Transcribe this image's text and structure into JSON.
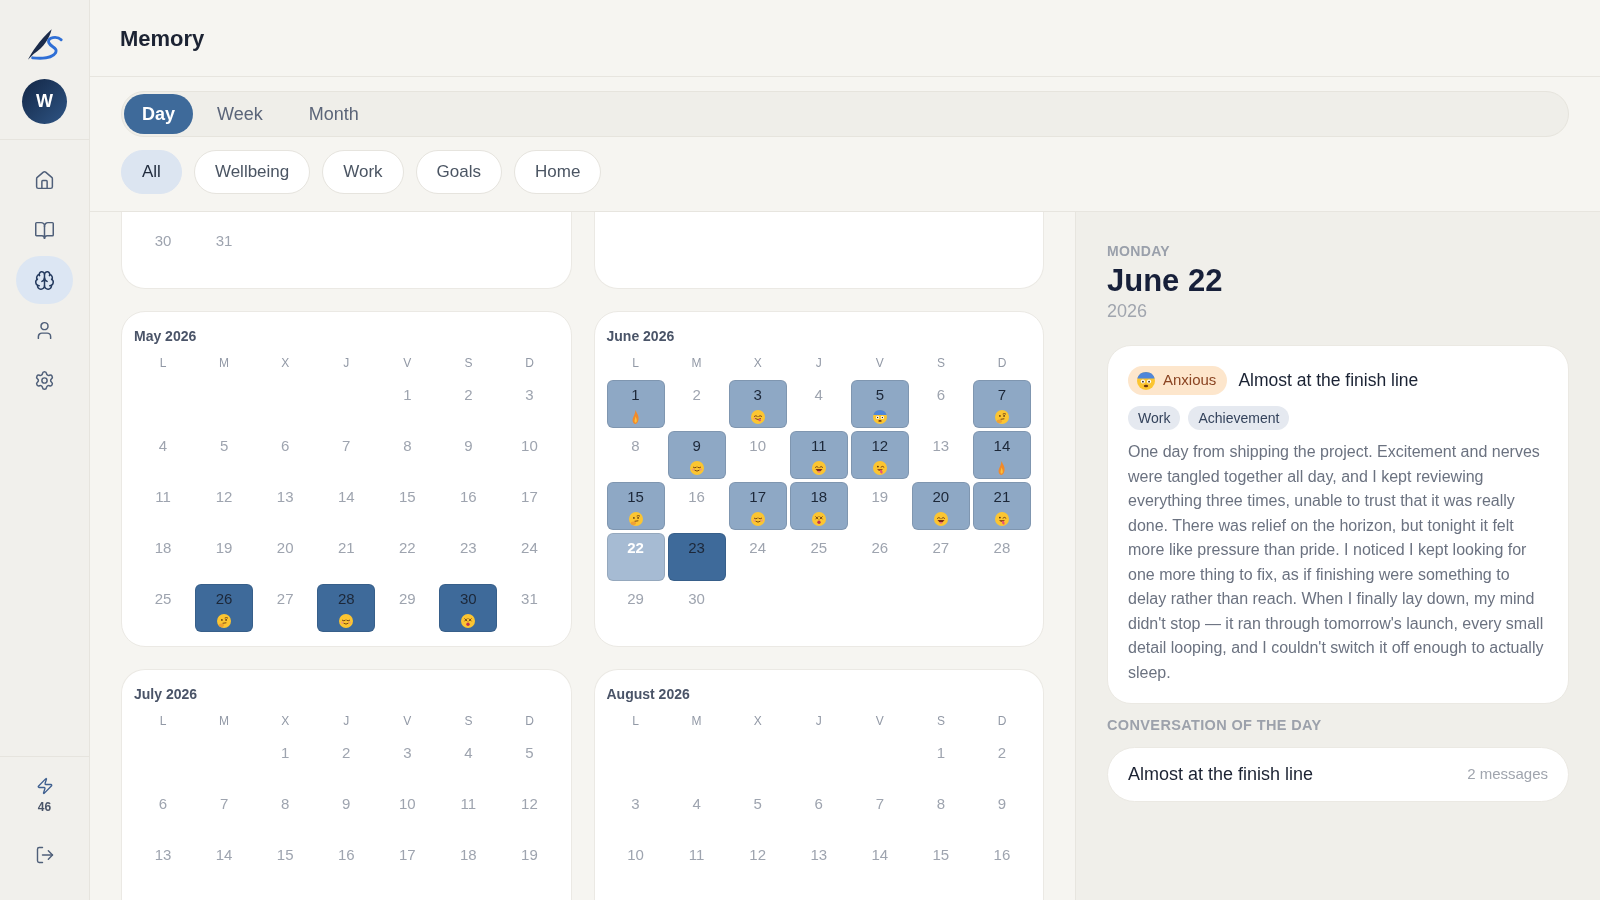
{
  "sidebar": {
    "avatar": {
      "initial": "W"
    },
    "nav": [
      {
        "kind": "home",
        "selected": false
      },
      {
        "kind": "journal",
        "selected": false
      },
      {
        "kind": "memory",
        "selected": true
      },
      {
        "kind": "profile",
        "selected": false
      },
      {
        "kind": "settings",
        "selected": false
      }
    ],
    "energy": {
      "count": "46"
    }
  },
  "header": {
    "title": "Memory"
  },
  "view_tabs": [
    {
      "label": "Day",
      "selected": true
    },
    {
      "label": "Week",
      "selected": false
    },
    {
      "label": "Month",
      "selected": false
    }
  ],
  "filters": [
    {
      "label": "All",
      "selected": true
    },
    {
      "label": "Wellbeing",
      "selected": false
    },
    {
      "label": "Work",
      "selected": false
    },
    {
      "label": "Goals",
      "selected": false
    },
    {
      "label": "Home",
      "selected": false
    }
  ],
  "calendar": {
    "months": [
      {
        "kind": "partial",
        "weeks": [
          [
            {
              "day": "30",
              "selected": false
            },
            {
              "day": "31",
              "selected": false
            }
          ]
        ]
      },
      {
        "kind": "partial"
      },
      {
        "kind": "month",
        "title": "May 2026",
        "weekdays": [
          "L",
          "M",
          "X",
          "J",
          "V",
          "S",
          "D"
        ],
        "weeks": [
          [
            {
              "day": "1",
              "selected": false
            },
            {
              "day": "2",
              "selected": false
            },
            {
              "day": "3",
              "selected": false
            }
          ],
          [
            {
              "day": "4",
              "selected": false
            },
            {
              "day": "5",
              "selected": false
            },
            {
              "day": "6",
              "selected": false
            },
            {
              "day": "7",
              "selected": false
            },
            {
              "day": "8",
              "selected": false
            },
            {
              "day": "9",
              "selected": false
            },
            {
              "day": "10",
              "selected": false
            }
          ],
          [
            {
              "day": "11",
              "selected": false
            },
            {
              "day": "12",
              "selected": false
            },
            {
              "day": "13",
              "selected": false
            },
            {
              "day": "14",
              "selected": false
            },
            {
              "day": "15",
              "selected": false
            },
            {
              "day": "16",
              "selected": false
            },
            {
              "day": "17",
              "selected": false
            }
          ],
          [
            {
              "day": "18",
              "selected": false
            },
            {
              "day": "19",
              "selected": false
            },
            {
              "day": "20",
              "selected": false
            },
            {
              "day": "21",
              "selected": false
            },
            {
              "day": "22",
              "selected": false
            },
            {
              "day": "23",
              "selected": false
            },
            {
              "day": "24",
              "selected": false
            }
          ],
          [
            {
              "day": "25",
              "selected": false
            },
            {
              "day": "26",
              "selected": false,
              "color": "#3e6a9a",
              "mood": {
                "kind": "thinking"
              }
            },
            {
              "day": "27",
              "selected": false
            },
            {
              "day": "28",
              "selected": false,
              "color": "#3e6a9a",
              "mood": {
                "kind": "relieved"
              }
            },
            {
              "day": "29",
              "selected": false
            },
            {
              "day": "30",
              "selected": false,
              "color": "#3e6a9a",
              "mood": {
                "kind": "dizzy"
              }
            },
            {
              "day": "31",
              "selected": false
            }
          ]
        ]
      },
      {
        "kind": "month",
        "title": "June 2026",
        "weekdays": [
          "L",
          "M",
          "X",
          "J",
          "V",
          "S",
          "D"
        ],
        "weeks": [
          [
            {
              "day": "1",
              "selected": false,
              "color": "#8ea8c5",
              "mood": {
                "kind": "flame"
              }
            },
            {
              "day": "2",
              "selected": false
            },
            {
              "day": "3",
              "selected": false,
              "color": "#8ea8c5",
              "mood": {
                "kind": "yum"
              }
            },
            {
              "day": "4",
              "selected": false
            },
            {
              "day": "5",
              "selected": false,
              "color": "#8ea8c5",
              "mood": {
                "kind": "anxious"
              }
            },
            {
              "day": "6",
              "selected": false
            },
            {
              "day": "7",
              "selected": false,
              "color": "#8ea8c5",
              "mood": {
                "kind": "thinking"
              }
            }
          ],
          [
            {
              "day": "8",
              "selected": false
            },
            {
              "day": "9",
              "selected": false,
              "color": "#8ea8c5",
              "mood": {
                "kind": "relieved"
              }
            },
            {
              "day": "10",
              "selected": false
            },
            {
              "day": "11",
              "selected": false,
              "color": "#8ea8c5",
              "mood": {
                "kind": "laughing"
              }
            },
            {
              "day": "12",
              "selected": false,
              "color": "#8ea8c5",
              "mood": {
                "kind": "silly"
              }
            },
            {
              "day": "13",
              "selected": false
            },
            {
              "day": "14",
              "selected": false,
              "color": "#8ea8c5",
              "mood": {
                "kind": "flame"
              }
            }
          ],
          [
            {
              "day": "15",
              "selected": false,
              "color": "#8ea8c5",
              "mood": {
                "kind": "thinking"
              }
            },
            {
              "day": "16",
              "selected": false
            },
            {
              "day": "17",
              "selected": false,
              "color": "#8ea8c5",
              "mood": {
                "kind": "relieved"
              }
            },
            {
              "day": "18",
              "selected": false,
              "color": "#8ea8c5",
              "mood": {
                "kind": "dizzy"
              }
            },
            {
              "day": "19",
              "selected": false
            },
            {
              "day": "20",
              "selected": false,
              "color": "#8ea8c5",
              "mood": {
                "kind": "laughing"
              }
            },
            {
              "day": "21",
              "selected": false,
              "color": "#8ea8c5",
              "mood": {
                "kind": "silly"
              }
            }
          ],
          [
            {
              "day": "22",
              "selected": true,
              "color": "#a6bbd3"
            },
            {
              "day": "23",
              "selected": false,
              "color": "#3e6a9a"
            },
            {
              "day": "24",
              "selected": false
            },
            {
              "day": "25",
              "selected": false
            },
            {
              "day": "26",
              "selected": false
            },
            {
              "day": "27",
              "selected": false
            },
            {
              "day": "28",
              "selected": false
            }
          ],
          [
            {
              "day": "29",
              "selected": false
            },
            {
              "day": "30",
              "selected": false
            }
          ]
        ]
      },
      {
        "kind": "month",
        "title": "July 2026",
        "weekdays": [
          "L",
          "M",
          "X",
          "J",
          "V",
          "S",
          "D"
        ],
        "weeks": [
          [
            {
              "day": "1",
              "selected": false
            },
            {
              "day": "2",
              "selected": false
            },
            {
              "day": "3",
              "selected": false
            },
            {
              "day": "4",
              "selected": false
            },
            {
              "day": "5",
              "selected": false
            }
          ],
          [
            {
              "day": "6",
              "selected": false
            },
            {
              "day": "7",
              "selected": false
            },
            {
              "day": "8",
              "selected": false
            },
            {
              "day": "9",
              "selected": false
            },
            {
              "day": "10",
              "selected": false
            },
            {
              "day": "11",
              "selected": false
            },
            {
              "day": "12",
              "selected": false
            }
          ],
          [
            {
              "day": "13",
              "selected": false
            },
            {
              "day": "14",
              "selected": false
            },
            {
              "day": "15",
              "selected": false
            },
            {
              "day": "16",
              "selected": false
            },
            {
              "day": "17",
              "selected": false
            },
            {
              "day": "18",
              "selected": false
            },
            {
              "day": "19",
              "selected": false
            }
          ]
        ]
      },
      {
        "kind": "month",
        "title": "August 2026",
        "weekdays": [
          "L",
          "M",
          "X",
          "J",
          "V",
          "S",
          "D"
        ],
        "weeks": [
          [
            {
              "day": "1",
              "selected": false
            },
            {
              "day": "2",
              "selected": false
            }
          ],
          [
            {
              "day": "3",
              "selected": false
            },
            {
              "day": "4",
              "selected": false
            },
            {
              "day": "5",
              "selected": false
            },
            {
              "day": "6",
              "selected": false
            },
            {
              "day": "7",
              "selected": false
            },
            {
              "day": "8",
              "selected": false
            },
            {
              "day": "9",
              "selected": false
            }
          ],
          [
            {
              "day": "10",
              "selected": false
            },
            {
              "day": "11",
              "selected": false
            },
            {
              "day": "12",
              "selected": false
            },
            {
              "day": "13",
              "selected": false
            },
            {
              "day": "14",
              "selected": false
            },
            {
              "day": "15",
              "selected": false
            },
            {
              "day": "16",
              "selected": false
            }
          ]
        ]
      }
    ]
  },
  "detail": {
    "weekday": "MONDAY",
    "date": "June 22",
    "year": "2026",
    "entry": {
      "mood": {
        "kind": "anxious",
        "label": "Anxious"
      },
      "title": "Almost at the finish line",
      "tags": [
        "Work",
        "Achievement"
      ],
      "text": "One day from shipping the project. Excitement and nerves were tangled together all day, and I kept reviewing everything three times, unable to trust that it was really done. There was relief on the horizon, but tonight it felt more like pressure than pride. I noticed I kept looking for one more thing to fix, as if finishing were something to delay rather than reach. When I finally lay down, my mind didn't stop — it ran through tomorrow's launch, every small detail looping, and I couldn't switch it off enough to actually sleep."
    },
    "conversation": {
      "heading": "CONVERSATION OF THE DAY",
      "title": "Almost at the finish line",
      "count": "2 messages"
    }
  }
}
